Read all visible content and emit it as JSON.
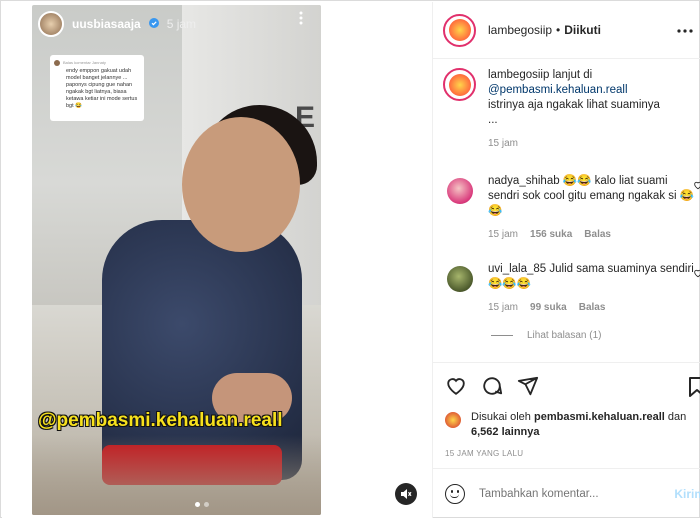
{
  "story": {
    "username": "uusbiasaaja",
    "verified_icon": "verified-badge-icon",
    "time": "5 jam",
    "reply_card": {
      "header": "Balas komentar Jannaty",
      "text": "endy emppon gakuat udah model banget jelannye ... paponys cipung gue nahan ngakak bgt liatnya, biasa ketawa ketiar ini mode sertus bgt 😂"
    },
    "background_letter": "E",
    "watermark": "@pembasmi.kehaluan.reall",
    "dots_total": 2,
    "dots_active": 1
  },
  "post": {
    "header": {
      "username": "lambegosiip",
      "separator": "•",
      "follow_label": "Diikuti",
      "more_icon": "more-horizontal-icon"
    },
    "caption": {
      "username": "lambegosiip",
      "text_prefix": "lanjut di",
      "mention": "@pembasmi.kehaluan.reall",
      "line2": "istrinya aja ngakak lihat suaminya",
      "ellipsis": "...",
      "time": "15 jam"
    },
    "comments": [
      {
        "username": "nadya_shihab",
        "text": "😂😂 kalo liat suami sendri sok cool gitu emang ngakak si 😂😂",
        "time": "15 jam",
        "likes": "156 suka",
        "reply": "Balas"
      },
      {
        "username": "uvi_lala_85",
        "text": "Julid sama suaminya sendiri 😂😂😂",
        "time": "15 jam",
        "likes": "99 suka",
        "reply": "Balas"
      }
    ],
    "view_replies": "Lihat balasan (1)",
    "liked_by": {
      "prefix": "Disukai oleh",
      "user": "pembasmi.kehaluan.reall",
      "connector": "dan",
      "count": "6,562 lainnya"
    },
    "posted_ago": "15 JAM YANG LALU",
    "composer": {
      "placeholder": "Tambahkan komentar...",
      "post_label": "Kirim"
    }
  }
}
